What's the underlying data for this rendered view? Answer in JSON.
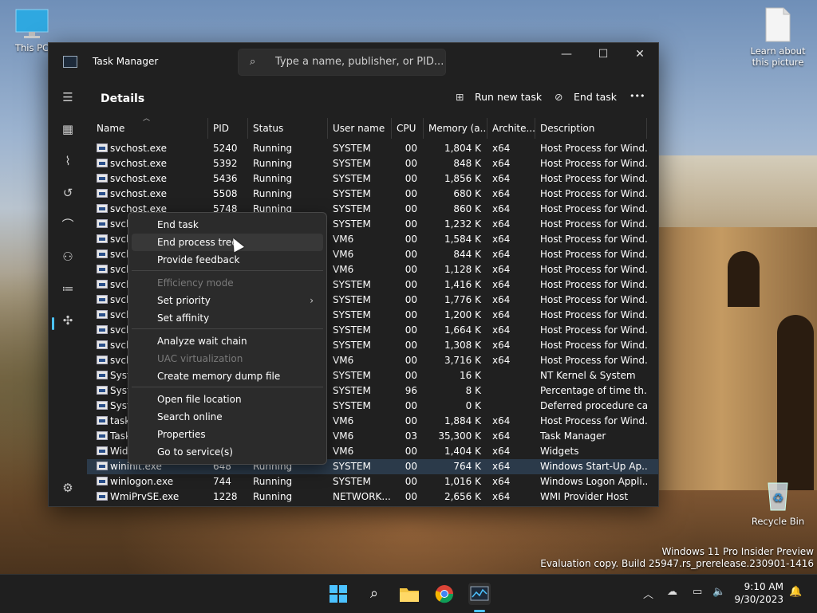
{
  "desktop": {
    "icons": [
      {
        "label": "This PC"
      },
      {
        "label": "Learn about this picture"
      },
      {
        "label": "Recycle Bin"
      }
    ],
    "watermark": {
      "line1": "Windows 11 Pro Insider Preview",
      "line2": "Evaluation copy. Build 25947.rs_prerelease.230901-1416"
    }
  },
  "window": {
    "title": "Task Manager",
    "search_placeholder": "Type a name, publisher, or PID...",
    "controls": {
      "minimize": "—",
      "maximize": "☐",
      "close": "✕"
    }
  },
  "page": {
    "title": "Details",
    "run_new_task": "Run new task",
    "end_task": "End task",
    "more": "•••"
  },
  "columns": [
    "Name",
    "PID",
    "Status",
    "User name",
    "CPU",
    "Memory (a...",
    "Archite...",
    "Description"
  ],
  "rows": [
    {
      "name": "svchost.exe",
      "pid": "5240",
      "status": "Running",
      "user": "SYSTEM",
      "cpu": "00",
      "mem": "1,804 K",
      "arch": "x64",
      "desc": "Host Process for Wind..."
    },
    {
      "name": "svchost.exe",
      "pid": "5392",
      "status": "Running",
      "user": "SYSTEM",
      "cpu": "00",
      "mem": "848 K",
      "arch": "x64",
      "desc": "Host Process for Wind..."
    },
    {
      "name": "svchost.exe",
      "pid": "5436",
      "status": "Running",
      "user": "SYSTEM",
      "cpu": "00",
      "mem": "1,856 K",
      "arch": "x64",
      "desc": "Host Process for Wind..."
    },
    {
      "name": "svchost.exe",
      "pid": "5508",
      "status": "Running",
      "user": "SYSTEM",
      "cpu": "00",
      "mem": "680 K",
      "arch": "x64",
      "desc": "Host Process for Wind..."
    },
    {
      "name": "svchost.exe",
      "pid": "5748",
      "status": "Running",
      "user": "SYSTEM",
      "cpu": "00",
      "mem": "860 K",
      "arch": "x64",
      "desc": "Host Process for Wind..."
    },
    {
      "name": "svcho",
      "pid": "",
      "status": "",
      "user": "SYSTEM",
      "cpu": "00",
      "mem": "1,232 K",
      "arch": "x64",
      "desc": "Host Process for Wind..."
    },
    {
      "name": "svcho",
      "pid": "",
      "status": "",
      "user": "VM6",
      "cpu": "00",
      "mem": "1,584 K",
      "arch": "x64",
      "desc": "Host Process for Wind..."
    },
    {
      "name": "svcho",
      "pid": "",
      "status": "",
      "user": "VM6",
      "cpu": "00",
      "mem": "844 K",
      "arch": "x64",
      "desc": "Host Process for Wind..."
    },
    {
      "name": "svcho",
      "pid": "",
      "status": "",
      "user": "VM6",
      "cpu": "00",
      "mem": "1,128 K",
      "arch": "x64",
      "desc": "Host Process for Wind..."
    },
    {
      "name": "svcho",
      "pid": "",
      "status": "",
      "user": "SYSTEM",
      "cpu": "00",
      "mem": "1,416 K",
      "arch": "x64",
      "desc": "Host Process for Wind..."
    },
    {
      "name": "svcho",
      "pid": "",
      "status": "",
      "user": "SYSTEM",
      "cpu": "00",
      "mem": "1,776 K",
      "arch": "x64",
      "desc": "Host Process for Wind..."
    },
    {
      "name": "svcho",
      "pid": "",
      "status": "",
      "user": "SYSTEM",
      "cpu": "00",
      "mem": "1,200 K",
      "arch": "x64",
      "desc": "Host Process for Wind..."
    },
    {
      "name": "svcho",
      "pid": "",
      "status": "",
      "user": "SYSTEM",
      "cpu": "00",
      "mem": "1,664 K",
      "arch": "x64",
      "desc": "Host Process for Wind..."
    },
    {
      "name": "svcho",
      "pid": "",
      "status": "",
      "user": "SYSTEM",
      "cpu": "00",
      "mem": "1,308 K",
      "arch": "x64",
      "desc": "Host Process for Wind..."
    },
    {
      "name": "svcho",
      "pid": "",
      "status": "",
      "user": "VM6",
      "cpu": "00",
      "mem": "3,716 K",
      "arch": "x64",
      "desc": "Host Process for Wind..."
    },
    {
      "name": "Syste",
      "pid": "",
      "status": "",
      "user": "SYSTEM",
      "cpu": "00",
      "mem": "16 K",
      "arch": "",
      "desc": "NT Kernel & System"
    },
    {
      "name": "Syste",
      "pid": "",
      "status": "",
      "user": "SYSTEM",
      "cpu": "96",
      "mem": "8 K",
      "arch": "",
      "desc": "Percentage of time th..."
    },
    {
      "name": "Syste",
      "pid": "",
      "status": "",
      "user": "SYSTEM",
      "cpu": "00",
      "mem": "0 K",
      "arch": "",
      "desc": "Deferred procedure ca..."
    },
    {
      "name": "taskh",
      "pid": "",
      "status": "",
      "user": "VM6",
      "cpu": "00",
      "mem": "1,884 K",
      "arch": "x64",
      "desc": "Host Process for Wind..."
    },
    {
      "name": "Taskn",
      "pid": "",
      "status": "",
      "user": "VM6",
      "cpu": "03",
      "mem": "35,300 K",
      "arch": "x64",
      "desc": "Task Manager"
    },
    {
      "name": "Widg",
      "pid": "",
      "status": "",
      "user": "VM6",
      "cpu": "00",
      "mem": "1,404 K",
      "arch": "x64",
      "desc": "Widgets"
    },
    {
      "name": "wininit.exe",
      "pid": "648",
      "status": "Running",
      "user": "SYSTEM",
      "cpu": "00",
      "mem": "764 K",
      "arch": "x64",
      "desc": "Windows Start-Up Ap..."
    },
    {
      "name": "winlogon.exe",
      "pid": "744",
      "status": "Running",
      "user": "SYSTEM",
      "cpu": "00",
      "mem": "1,016 K",
      "arch": "x64",
      "desc": "Windows Logon Appli..."
    },
    {
      "name": "WmiPrvSE.exe",
      "pid": "1228",
      "status": "Running",
      "user": "NETWORK...",
      "cpu": "00",
      "mem": "2,656 K",
      "arch": "x64",
      "desc": "WMI Provider Host"
    }
  ],
  "context_menu": {
    "items": [
      "End task",
      "End process tree",
      "Provide feedback",
      "Efficiency mode",
      "Set priority",
      "Set affinity",
      "Analyze wait chain",
      "UAC virtualization",
      "Create memory dump file",
      "Open file location",
      "Search online",
      "Properties",
      "Go to service(s)"
    ],
    "submenu_arrow": "›"
  },
  "taskbar": {
    "time": "9:10 AM",
    "date": "9/30/2023"
  },
  "colors": {
    "accent": "#4cc2ff",
    "window_bg": "#202020",
    "menu_bg": "#2b2b2b",
    "selected_row": "#2b3a4a"
  }
}
